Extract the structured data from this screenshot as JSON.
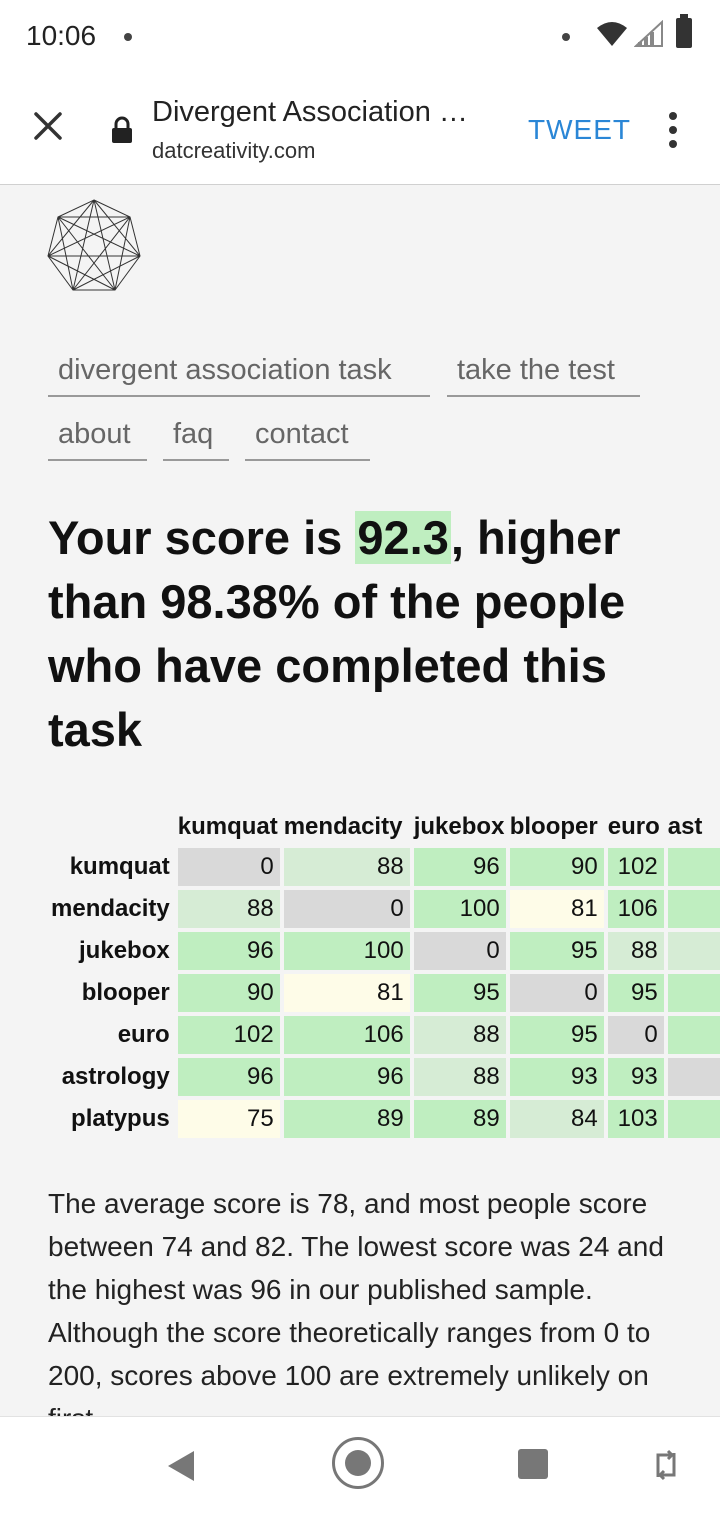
{
  "status_bar": {
    "time": "10:06"
  },
  "browser": {
    "page_title": "Divergent Association …",
    "domain": "datcreativity.com",
    "tweet_label": "TWEET"
  },
  "nav": {
    "items": [
      "divergent association task",
      "take the test",
      "about",
      "faq",
      "contact"
    ]
  },
  "result": {
    "prefix": "Your score is ",
    "score": "92.3",
    "suffix": ", higher than 98.38% of the people who have completed this task"
  },
  "matrix": {
    "columns": [
      "kumquat",
      "mendacity",
      "jukebox",
      "blooper",
      "euro",
      "ast"
    ],
    "rows": [
      {
        "label": "kumquat",
        "cells": [
          "0",
          "88",
          "96",
          "90",
          "102",
          ""
        ]
      },
      {
        "label": "mendacity",
        "cells": [
          "88",
          "0",
          "100",
          "81",
          "106",
          ""
        ]
      },
      {
        "label": "jukebox",
        "cells": [
          "96",
          "100",
          "0",
          "95",
          "88",
          ""
        ]
      },
      {
        "label": "blooper",
        "cells": [
          "90",
          "81",
          "95",
          "0",
          "95",
          ""
        ]
      },
      {
        "label": "euro",
        "cells": [
          "102",
          "106",
          "88",
          "95",
          "0",
          ""
        ]
      },
      {
        "label": "astrology",
        "cells": [
          "96",
          "96",
          "88",
          "93",
          "93",
          ""
        ]
      },
      {
        "label": "platypus",
        "cells": [
          "75",
          "89",
          "89",
          "84",
          "103",
          ""
        ]
      }
    ],
    "shades": [
      [
        "c0",
        "cl",
        "cg",
        "cg",
        "cg",
        "cg"
      ],
      [
        "cl",
        "c0",
        "cg",
        "cy",
        "cg",
        "cg"
      ],
      [
        "cg",
        "cg",
        "c0",
        "cg",
        "cl",
        "cl"
      ],
      [
        "cg",
        "cy",
        "cg",
        "c0",
        "cg",
        "cg"
      ],
      [
        "cg",
        "cg",
        "cl",
        "cg",
        "c0",
        "cg"
      ],
      [
        "cg",
        "cg",
        "cl",
        "cg",
        "cg",
        "c0"
      ],
      [
        "cy",
        "cg",
        "cg",
        "cl",
        "cg",
        "cg"
      ]
    ]
  },
  "summary": "The average score is 78, and most people score between 74 and 82. The lowest score was 24 and the highest was 96 in our published sample. Although the score theoretically ranges from 0 to 200, scores above 100 are extremely unlikely on first"
}
